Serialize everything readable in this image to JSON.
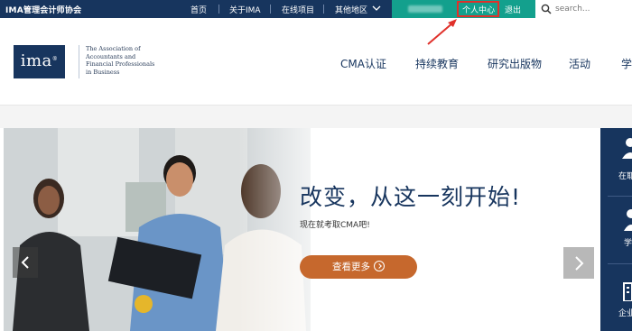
{
  "topbar": {
    "org_name": "IMA管理会计师协会",
    "nav": [
      "首页",
      "关于IMA",
      "在线项目",
      "其他地区"
    ],
    "account_center": "个人中心",
    "logout": "退出",
    "search_placeholder": "search..."
  },
  "header": {
    "logo_text": "ima",
    "logo_mark": "®",
    "tagline": [
      "The Association of",
      "Accountants and",
      "Financial Professionals",
      "in Business"
    ],
    "nav": [
      "CMA认证",
      "持续教育",
      "研究出版物",
      "活动",
      "学"
    ]
  },
  "hero": {
    "title": "改变，从这一刻开始!",
    "subtitle": "现在就考取CMA吧!",
    "cta_label": "查看更多"
  },
  "side_rail": [
    "在耶",
    "学",
    "企业"
  ],
  "colors": {
    "navy": "#17355e",
    "teal": "#13a08d",
    "orange": "#c6682d",
    "annotation_red": "#e0302a"
  },
  "icons": [
    "chevron-down-icon",
    "search-icon",
    "chevron-left-icon",
    "chevron-right-icon",
    "arrow-right-circle-icon",
    "user-icon",
    "graduate-icon",
    "building-icon"
  ]
}
